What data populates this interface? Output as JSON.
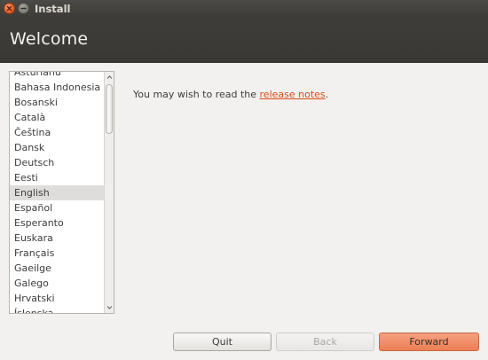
{
  "window": {
    "title": "Install"
  },
  "header": {
    "title": "Welcome"
  },
  "languages": {
    "items": [
      "Asturianu",
      "Bahasa Indonesia",
      "Bosanski",
      "Català",
      "Čeština",
      "Dansk",
      "Deutsch",
      "Eesti",
      "English",
      "Español",
      "Esperanto",
      "Euskara",
      "Français",
      "Gaeilge",
      "Galego",
      "Hrvatski",
      "Íslenska"
    ],
    "selected": "English"
  },
  "notes": {
    "prefix": "You may wish to read the ",
    "link": "release notes",
    "suffix": "."
  },
  "buttons": {
    "quit": "Quit",
    "back": "Back",
    "forward": "Forward"
  },
  "colors": {
    "accent": "#dd4814",
    "header_bg": "#3c3b37",
    "forward_button": "#ef8b64"
  }
}
